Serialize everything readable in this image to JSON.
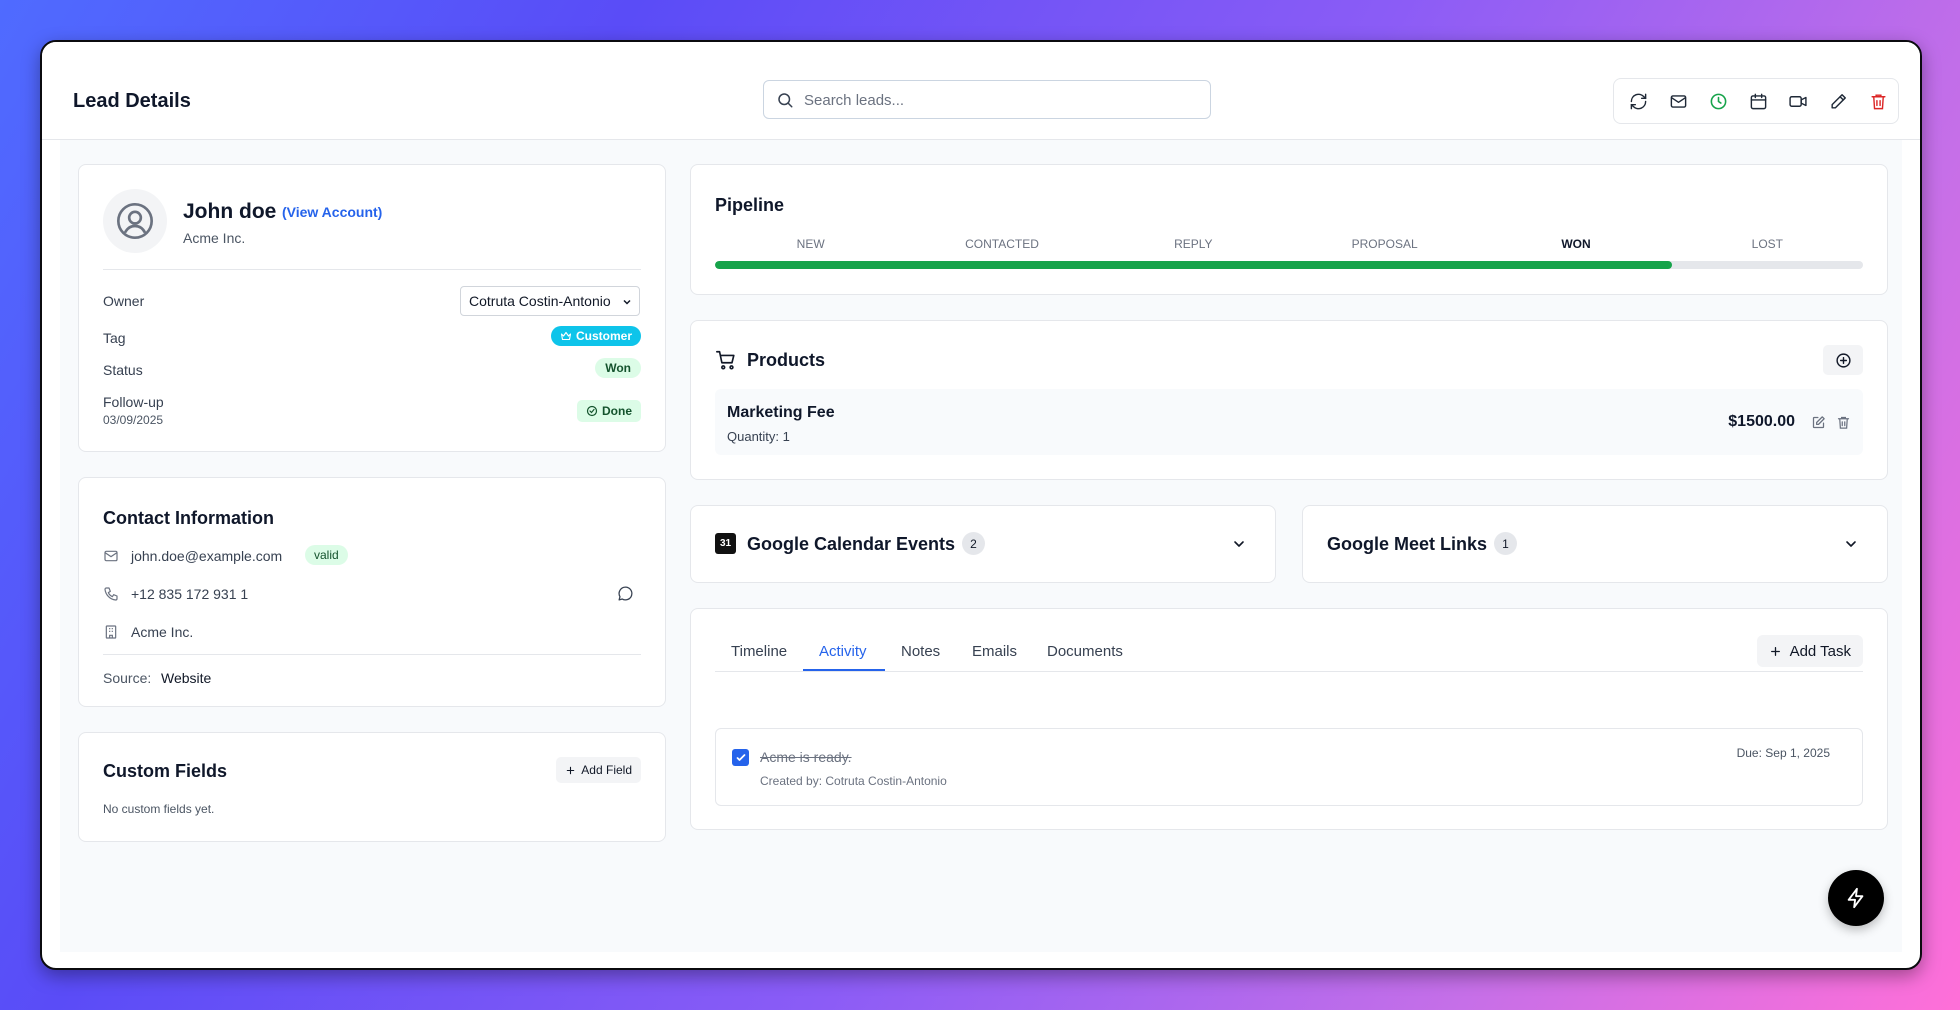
{
  "header": {
    "title": "Lead Details",
    "search_placeholder": "Search leads...",
    "toolbar_icons": [
      "refresh-icon",
      "mail-icon",
      "clock-icon",
      "calendar-icon",
      "video-icon",
      "edit-icon",
      "trash-icon"
    ],
    "colors": {
      "clock": "#16a34a",
      "trash": "#dc2626"
    }
  },
  "profile": {
    "name": "John doe",
    "view_account": "(View Account)",
    "company": "Acme Inc.",
    "owner_label": "Owner",
    "owner_value": "Cotruta Costin-Antonio",
    "owner_options": [
      "Cotruta Costin-Antonio"
    ],
    "tag_label": "Tag",
    "tag_value": "Customer",
    "status_label": "Status",
    "status_value": "Won",
    "followup_label": "Follow-up",
    "followup_date": "03/09/2025",
    "followup_status": "Done"
  },
  "contact": {
    "title": "Contact Information",
    "email": "john.doe@example.com",
    "email_badge": "valid",
    "phone": "+12 835 172 931 1",
    "company": "Acme Inc.",
    "source_label": "Source:",
    "source_value": "Website"
  },
  "custom_fields": {
    "title": "Custom Fields",
    "add_label": "Add Field",
    "empty": "No custom fields yet."
  },
  "pipeline": {
    "title": "Pipeline",
    "stages": [
      "NEW",
      "CONTACTED",
      "REPLY",
      "PROPOSAL",
      "WON",
      "LOST"
    ],
    "current_stage": "WON",
    "progress": 0.834,
    "color": "#16a34a"
  },
  "products": {
    "title": "Products",
    "items": [
      {
        "name": "Marketing Fee",
        "quantity": "Quantity: 1",
        "price": "$1500.00"
      }
    ]
  },
  "calendar": {
    "title": "Google Calendar Events",
    "count": "2",
    "icon_text": "31"
  },
  "meet": {
    "title": "Google Meet Links",
    "count": "1"
  },
  "activity": {
    "tabs": [
      "Timeline",
      "Activity",
      "Notes",
      "Emails",
      "Documents"
    ],
    "active_tab": "Activity",
    "add_task": "Add Task",
    "tasks": [
      {
        "title": "Acme is ready.",
        "created": "Created by: Cotruta Costin-Antonio",
        "due": "Due: Sep 1, 2025",
        "done": true
      }
    ]
  },
  "accent": "#2563eb"
}
